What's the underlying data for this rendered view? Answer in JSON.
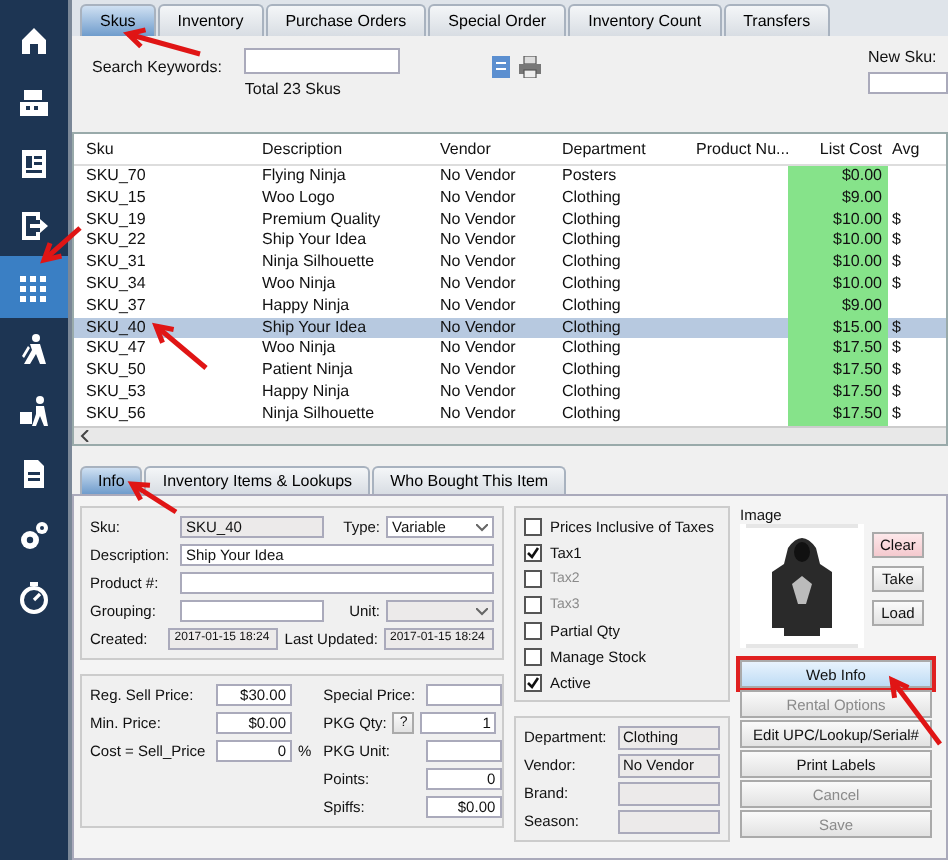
{
  "sidebar": {
    "items": [
      {
        "kind": "home",
        "selected": false
      },
      {
        "kind": "register",
        "selected": false
      },
      {
        "kind": "invoice",
        "selected": false
      },
      {
        "kind": "exit",
        "selected": false
      },
      {
        "kind": "grid",
        "selected": true
      },
      {
        "kind": "hiker",
        "selected": false
      },
      {
        "kind": "cart",
        "selected": false
      },
      {
        "kind": "document",
        "selected": false
      },
      {
        "kind": "gears",
        "selected": false
      },
      {
        "kind": "stopwatch",
        "selected": false
      }
    ]
  },
  "tabs": [
    {
      "label": "Skus",
      "selected": true
    },
    {
      "label": "Inventory",
      "selected": false
    },
    {
      "label": "Purchase Orders",
      "selected": false
    },
    {
      "label": "Special Order",
      "selected": false
    },
    {
      "label": "Inventory Count",
      "selected": false
    },
    {
      "label": "Transfers",
      "selected": false
    }
  ],
  "search": {
    "label": "Search Keywords:",
    "total": "Total 23 Skus",
    "new_sku_label": "New Sku:"
  },
  "table": {
    "columns": [
      "Sku",
      "Description",
      "Vendor",
      "Department",
      "Product Nu...",
      "List Cost",
      "Avg"
    ],
    "rows": [
      {
        "sku": "SKU_70",
        "description": "Flying Ninja",
        "vendor": "No Vendor",
        "department": "Posters",
        "list_cost": "$0.00",
        "selected": false
      },
      {
        "sku": "SKU_15",
        "description": "Woo Logo",
        "vendor": "No Vendor",
        "department": "Clothing",
        "list_cost": "$9.00",
        "selected": false
      },
      {
        "sku": "SKU_19",
        "description": "Premium Quality",
        "vendor": "No Vendor",
        "department": "Clothing",
        "list_cost": "$10.00",
        "avg": "$",
        "selected": false
      },
      {
        "sku": "SKU_22",
        "description": "Ship Your Idea",
        "vendor": "No Vendor",
        "department": "Clothing",
        "list_cost": "$10.00",
        "avg": "$",
        "selected": false
      },
      {
        "sku": "SKU_31",
        "description": "Ninja Silhouette",
        "vendor": "No Vendor",
        "department": "Clothing",
        "list_cost": "$10.00",
        "avg": "$",
        "selected": false
      },
      {
        "sku": "SKU_34",
        "description": "Woo Ninja",
        "vendor": "No Vendor",
        "department": "Clothing",
        "list_cost": "$10.00",
        "avg": "$",
        "selected": false
      },
      {
        "sku": "SKU_37",
        "description": "Happy Ninja",
        "vendor": "No Vendor",
        "department": "Clothing",
        "list_cost": "$9.00",
        "selected": false
      },
      {
        "sku": "SKU_40",
        "description": "Ship Your Idea",
        "vendor": "No Vendor",
        "department": "Clothing",
        "list_cost": "$15.00",
        "avg": "$",
        "selected": true
      },
      {
        "sku": "SKU_47",
        "description": "Woo Ninja",
        "vendor": "No Vendor",
        "department": "Clothing",
        "list_cost": "$17.50",
        "avg": "$",
        "selected": false
      },
      {
        "sku": "SKU_50",
        "description": "Patient Ninja",
        "vendor": "No Vendor",
        "department": "Clothing",
        "list_cost": "$17.50",
        "avg": "$",
        "selected": false
      },
      {
        "sku": "SKU_53",
        "description": "Happy Ninja",
        "vendor": "No Vendor",
        "department": "Clothing",
        "list_cost": "$17.50",
        "avg": "$",
        "selected": false
      },
      {
        "sku": "SKU_56",
        "description": "Ninja Silhouette",
        "vendor": "No Vendor",
        "department": "Clothing",
        "list_cost": "$17.50",
        "avg": "$",
        "selected": false
      }
    ]
  },
  "detail_tabs": [
    {
      "label": "Info",
      "selected": true
    },
    {
      "label": "Inventory Items & Lookups",
      "selected": false
    },
    {
      "label": "Who Bought This Item",
      "selected": false
    }
  ],
  "info": {
    "sku": {
      "label": "Sku:",
      "value": "SKU_40",
      "disabled": true
    },
    "type": {
      "label": "Type:",
      "value": "Variable",
      "disabled": false
    },
    "description": {
      "label": "Description:",
      "value": "Ship Your Idea",
      "disabled": false
    },
    "product_no": {
      "label": "Product #:",
      "disabled": false
    },
    "grouping": {
      "label": "Grouping:",
      "disabled": false
    },
    "unit": {
      "label": "Unit:",
      "disabled": true
    },
    "created": {
      "label": "Created:",
      "value": "2017-01-15 18:24",
      "disabled": true
    },
    "last_updated": {
      "label": "Last Updated:",
      "value": "2017-01-15 18:24",
      "disabled": true
    }
  },
  "pricing": {
    "left": [
      {
        "label": "Reg. Sell Price:",
        "value": "$30.00"
      },
      {
        "label": "Min. Price:",
        "value": "$0.00"
      },
      {
        "label": "Cost = Sell_Price",
        "value": "0",
        "suffix": "%"
      }
    ],
    "right": [
      {
        "label": "Special Price:"
      },
      {
        "label": "PKG Qty:",
        "help": "?",
        "value": "1"
      },
      {
        "label": "PKG Unit:"
      },
      {
        "label": "Points:",
        "value": "0"
      },
      {
        "label": "Spiffs:",
        "value": "$0.00"
      }
    ]
  },
  "options": [
    {
      "label": "Prices Inclusive of Taxes",
      "checked": false,
      "disabled": false
    },
    {
      "label": "Tax1",
      "checked": true,
      "disabled": false
    },
    {
      "label": "Tax2",
      "checked": false,
      "disabled": true
    },
    {
      "label": "Tax3",
      "checked": false,
      "disabled": true
    },
    {
      "label": "Partial Qty",
      "checked": false,
      "disabled": false
    },
    {
      "label": "Manage Stock",
      "checked": false,
      "disabled": false
    },
    {
      "label": "Active",
      "checked": true,
      "disabled": false
    }
  ],
  "attributes": [
    {
      "label": "Department:",
      "value": "Clothing"
    },
    {
      "label": "Vendor:",
      "value": "No Vendor"
    },
    {
      "label": "Brand:"
    },
    {
      "label": "Season:"
    }
  ],
  "image": {
    "label": "Image",
    "buttons": [
      {
        "label": "Clear",
        "kind": "danger"
      },
      {
        "label": "Take",
        "kind": "normal"
      },
      {
        "label": "Load",
        "kind": "normal"
      }
    ]
  },
  "actions": [
    {
      "label": "Web Info",
      "highlighted": true,
      "disabled": false
    },
    {
      "label": "Rental Options",
      "highlighted": false,
      "disabled": true
    },
    {
      "label": "Edit UPC/Lookup/Serial#",
      "highlighted": false,
      "disabled": false
    },
    {
      "label": "Print Labels",
      "highlighted": false,
      "disabled": false
    },
    {
      "label": "Cancel",
      "highlighted": false,
      "disabled": true
    },
    {
      "label": "Save",
      "highlighted": false,
      "disabled": true
    }
  ]
}
